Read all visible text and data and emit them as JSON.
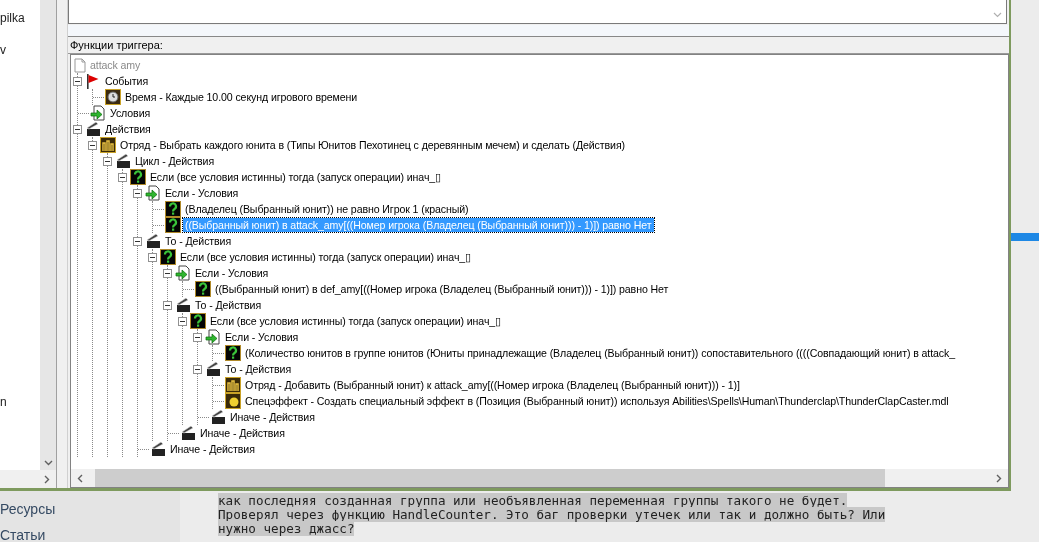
{
  "trigger_list": {
    "items": [
      {
        "label": "pilka",
        "selected": false
      },
      {
        "label": "v",
        "selected": false
      },
      {
        "label": "n",
        "selected": false
      }
    ]
  },
  "editor": {
    "group_label": "Функции триггера:",
    "tree": {
      "label": "attack amy",
      "kind": "trigger",
      "selected": false,
      "children": [
        {
          "label": "События",
          "kind": "events",
          "expanded": true,
          "selected": false,
          "children": [
            {
              "label": "Время - Каждые 10.00 секунд игрового времени",
              "kind": "timer",
              "selected": false
            }
          ]
        },
        {
          "label": "Условия",
          "kind": "conditions",
          "selected": false
        },
        {
          "label": "Действия",
          "kind": "actions",
          "expanded": true,
          "selected": false,
          "children": [
            {
              "label": "Отряд - Выбрать каждого юнита в (Типы Юнитов Пехотинец с деревянным мечем) и сделать (Действия)",
              "kind": "unit-group",
              "expanded": true,
              "selected": false,
              "children": [
                {
                  "label": "Цикл - Действия",
                  "kind": "actions",
                  "expanded": true,
                  "selected": false,
                  "children": [
                    {
                      "label": "Если (все условия истинны) тогда (запуск операции) инач_▯",
                      "kind": "question",
                      "expanded": true,
                      "selected": false,
                      "children": [
                        {
                          "label": "Если - Условия",
                          "kind": "conditions",
                          "expanded": true,
                          "selected": false,
                          "children": [
                            {
                              "label": "(Владелец (Выбранный юнит)) не равно Игрок 1 (красный)",
                              "kind": "question",
                              "selected": false
                            },
                            {
                              "label": "((Выбранный юнит) в attack_amy[((Номер игрока (Владелец (Выбранный юнит))) - 1)]) равно Нет",
                              "kind": "question",
                              "selected": true
                            }
                          ]
                        },
                        {
                          "label": "То - Действия",
                          "kind": "actions",
                          "expanded": true,
                          "selected": false,
                          "children": [
                            {
                              "label": "Если (все условия истинны) тогда (запуск операции) инач_▯",
                              "kind": "question",
                              "expanded": true,
                              "selected": false,
                              "children": [
                                {
                                  "label": "Если - Условия",
                                  "kind": "conditions",
                                  "expanded": true,
                                  "selected": false,
                                  "children": [
                                    {
                                      "label": "((Выбранный юнит) в def_amy[((Номер игрока (Владелец (Выбранный юнит))) - 1)]) равно Нет",
                                      "kind": "question",
                                      "selected": false
                                    }
                                  ]
                                },
                                {
                                  "label": "То - Действия",
                                  "kind": "actions",
                                  "expanded": true,
                                  "selected": false,
                                  "children": [
                                    {
                                      "label": "Если (все условия истинны) тогда (запуск операции) инач_▯",
                                      "kind": "question",
                                      "expanded": true,
                                      "selected": false,
                                      "children": [
                                        {
                                          "label": "Если - Условия",
                                          "kind": "conditions",
                                          "expanded": true,
                                          "selected": false,
                                          "children": [
                                            {
                                              "label": "(Количество юнитов в группе юнитов (Юниты принадлежащие (Владелец (Выбранный юнит)) сопоставительного ((((Совпадающий юнит) в attack_",
                                              "kind": "question",
                                              "selected": false
                                            }
                                          ]
                                        },
                                        {
                                          "label": "То - Действия",
                                          "kind": "actions",
                                          "expanded": true,
                                          "selected": false,
                                          "children": [
                                            {
                                              "label": "Отряд - Добавить (Выбранный юнит) к attack_amy[((Номер игрока (Владелец (Выбранный юнит))) - 1)]",
                                              "kind": "unit-group",
                                              "selected": false
                                            },
                                            {
                                              "label": "Спецэффект - Создать специальный эффект в (Позиция (Выбранный юнит)) используя Abilities\\Spells\\Human\\Thunderclap\\ThunderClapCaster.mdl",
                                              "kind": "effect",
                                              "selected": false
                                            }
                                          ]
                                        },
                                        {
                                          "label": "Иначе - Действия",
                                          "kind": "actions",
                                          "selected": false
                                        }
                                      ]
                                    }
                                  ]
                                },
                                {
                                  "label": "Иначе - Действия",
                                  "kind": "actions",
                                  "selected": false
                                }
                              ]
                            }
                          ]
                        },
                        {
                          "label": "Иначе - Действия",
                          "kind": "actions",
                          "selected": false
                        }
                      ]
                    }
                  ]
                }
              ]
            }
          ]
        }
      ]
    }
  },
  "page": {
    "nav": [
      "Ресурсы",
      "Статьи"
    ],
    "post_lines": [
      "как последняя созданная группа или необъявленная переменная группы такого не будет.",
      "Проверял через функцию HandleCounter. Это баг проверки утечек или так и должно быть? Или",
      "нужно через джасс?"
    ]
  }
}
